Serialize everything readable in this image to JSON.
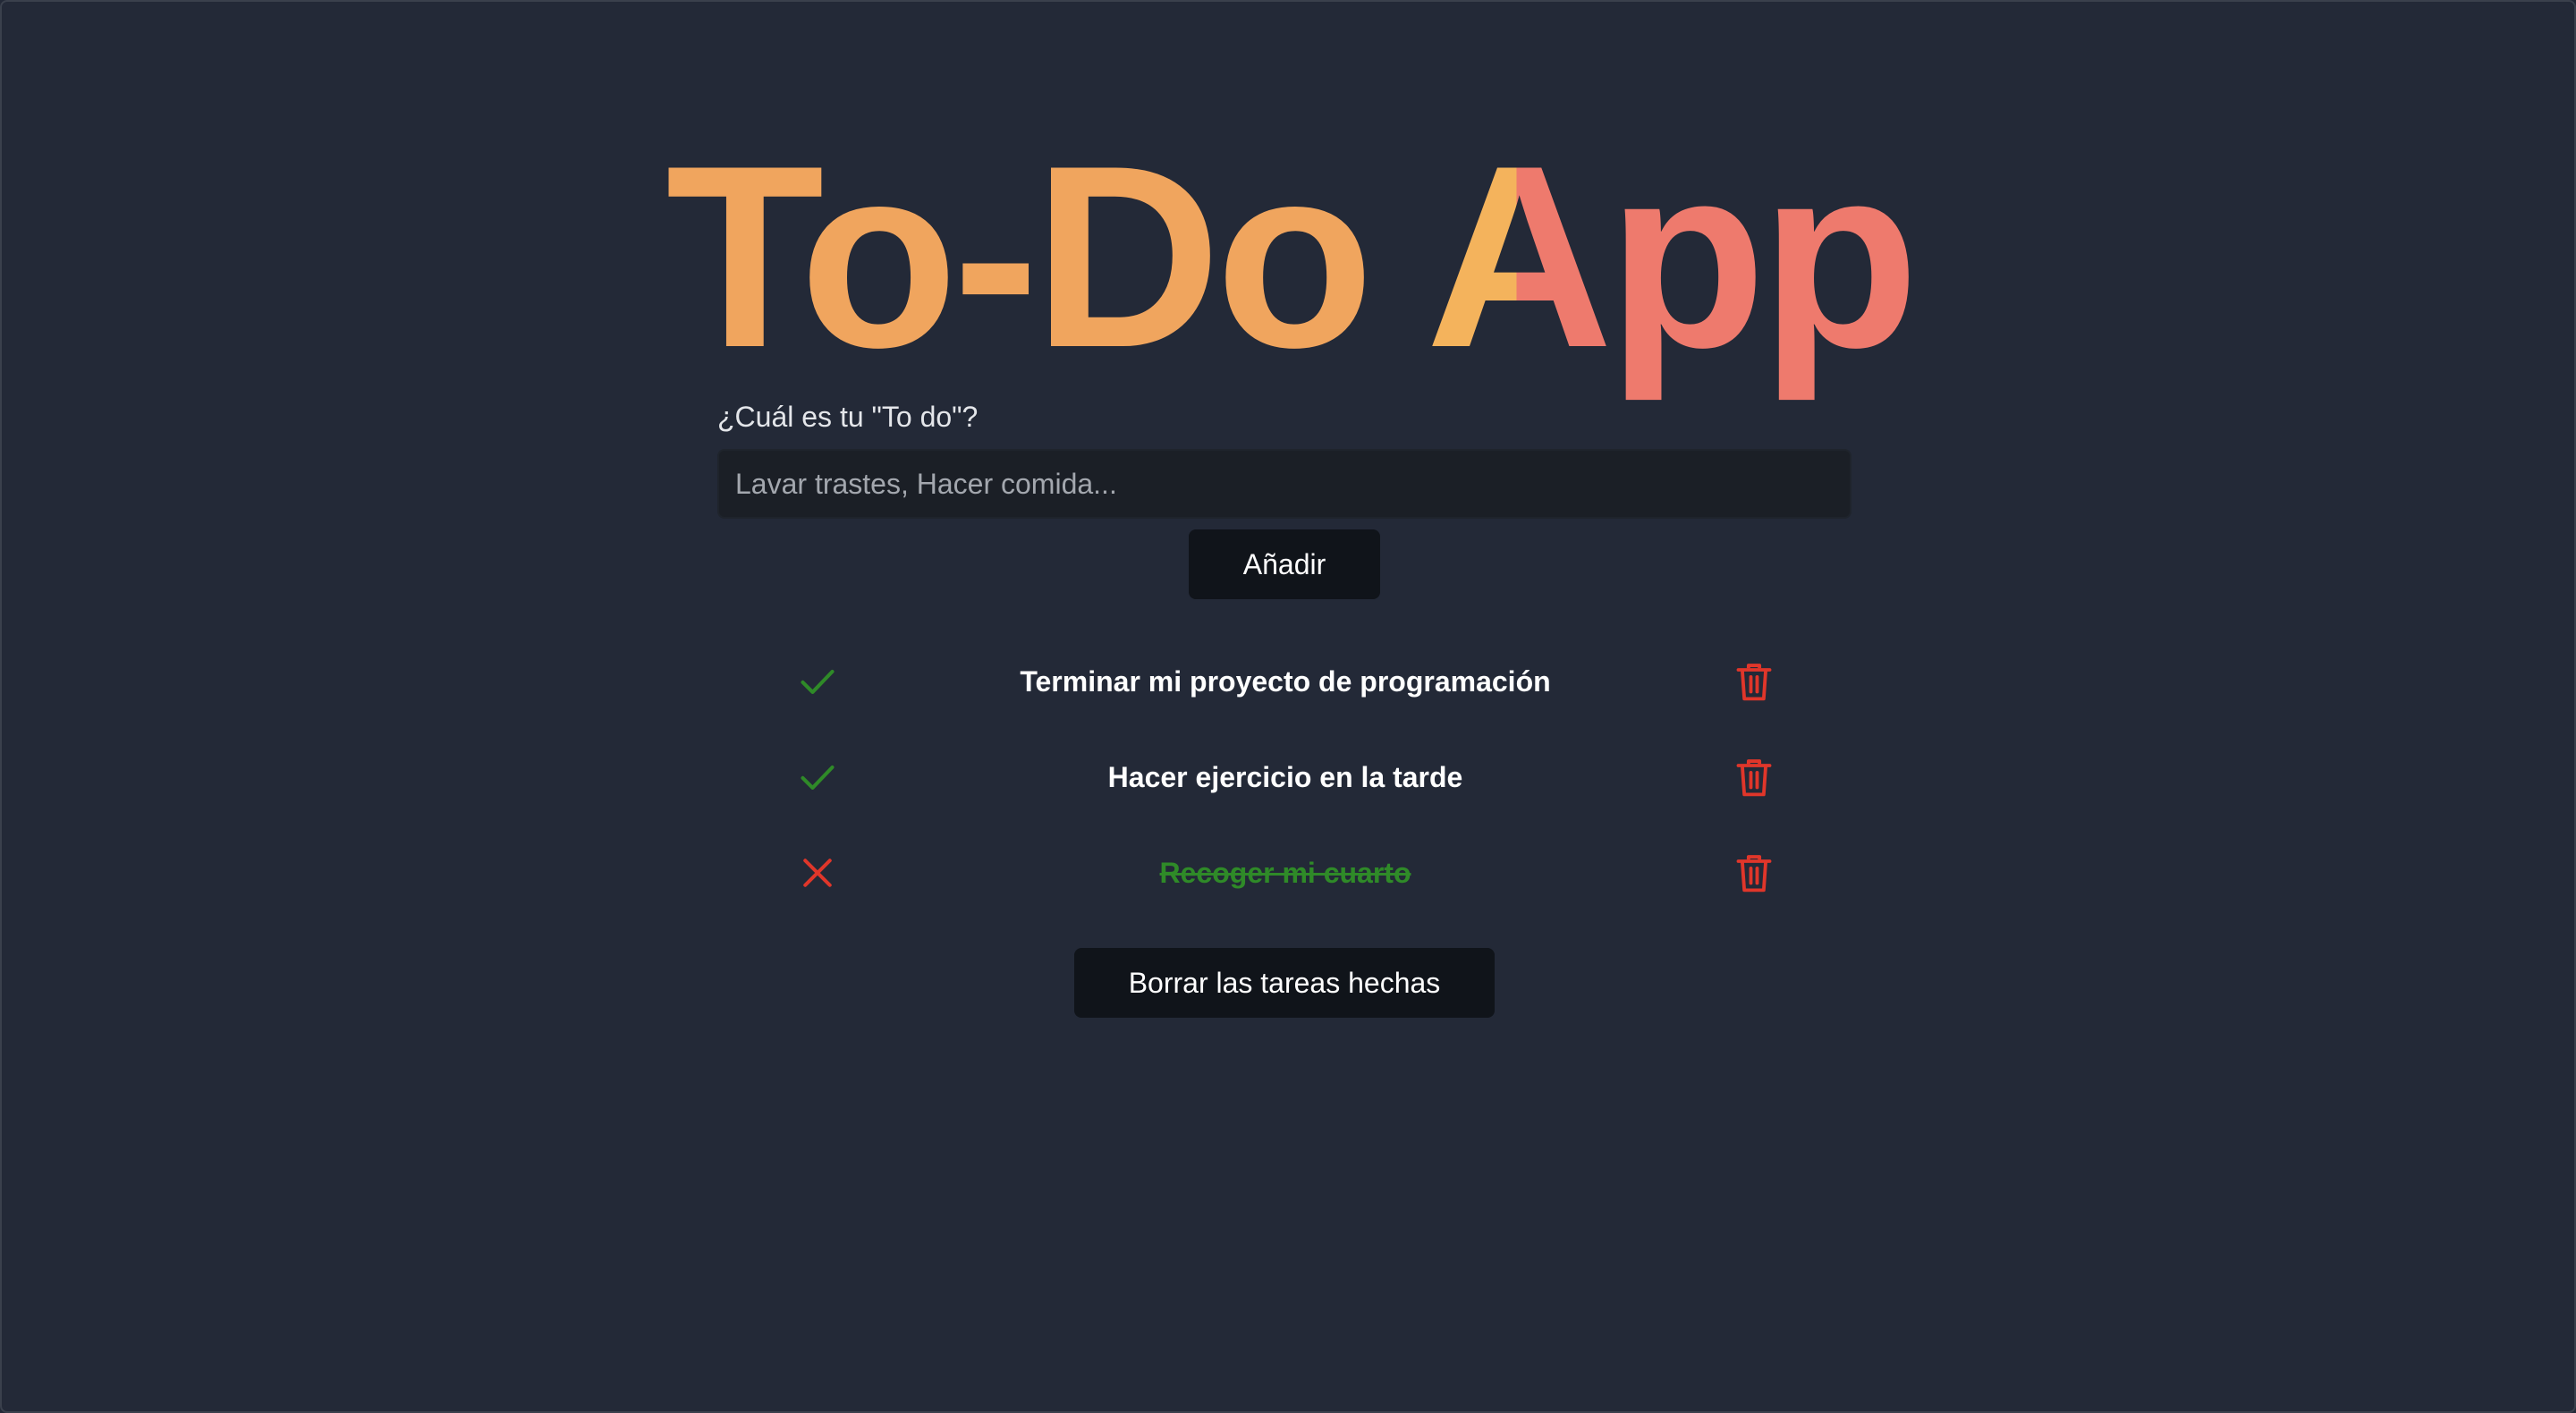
{
  "app": {
    "title_main": "To-Do ",
    "title_a": "A",
    "title_rest": "pp"
  },
  "form": {
    "label": "¿Cuál es tu \"To do\"?",
    "input_value": "",
    "input_placeholder": "Lavar trastes, Hacer comida...",
    "add_button_label": "Añadir"
  },
  "todos": [
    {
      "text": "Terminar mi proyecto de programación",
      "status_icon": "check-icon",
      "done": false
    },
    {
      "text": "Hacer ejercicio en la tarde",
      "status_icon": "check-icon",
      "done": false
    },
    {
      "text": "Recoger mi cuarto",
      "status_icon": "x-icon",
      "done": true
    }
  ],
  "actions": {
    "clear_done_label": "Borrar las tareas hechas"
  },
  "colors": {
    "background": "#232937",
    "title_orange": "#f0a55e",
    "title_coral": "#ee7a6d",
    "check_green": "#2f8a28",
    "delete_red": "#e0362a",
    "button_bg": "#10141a",
    "input_bg": "#1b1f26"
  }
}
